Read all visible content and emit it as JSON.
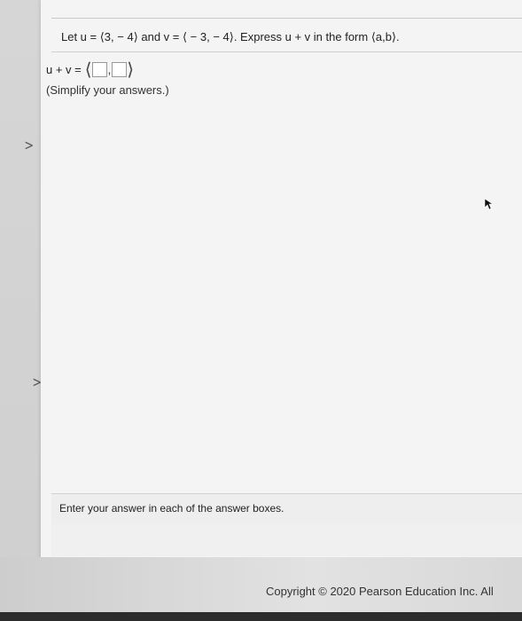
{
  "question": {
    "text": "Let u = ⟨3, − 4⟩ and v = ⟨ − 3, − 4⟩. Express u + v in the form ⟨a,b⟩."
  },
  "answer": {
    "label": "u + v =",
    "box_a_value": "",
    "box_b_value": "",
    "separator": ","
  },
  "instructions": {
    "simplify": "(Simplify your answers.)",
    "enter_answer": "Enter your answer in each of the answer boxes."
  },
  "footer": {
    "copyright": "Copyright © 2020 Pearson Education Inc. All"
  },
  "icons": {
    "left_chevron_1": "chevron-right-icon",
    "left_chevron_2": "chevron-right-icon",
    "cursor": "mouse-pointer-icon"
  }
}
